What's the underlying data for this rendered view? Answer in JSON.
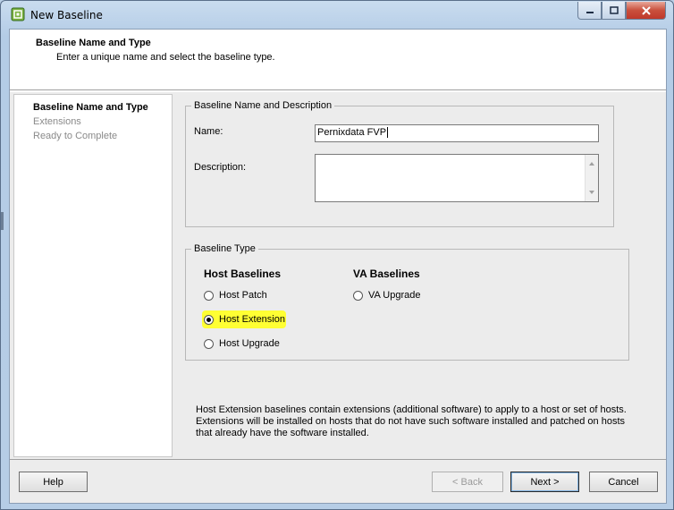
{
  "window": {
    "title": "New Baseline"
  },
  "header": {
    "title": "Baseline Name and Type",
    "subtitle": "Enter a unique name and select the baseline type."
  },
  "nav": {
    "items": [
      {
        "label": "Baseline Name and Type",
        "state": "active"
      },
      {
        "label": "Extensions",
        "state": "inactive"
      },
      {
        "label": "Ready to Complete",
        "state": "inactive"
      }
    ]
  },
  "name_group": {
    "legend": "Baseline Name and Description",
    "name_label": "Name:",
    "name_value": "Pernixdata FVP",
    "description_label": "Description:",
    "description_value": ""
  },
  "type_group": {
    "legend": "Baseline Type",
    "host_heading": "Host Baselines",
    "va_heading": "VA Baselines",
    "options": [
      {
        "label": "Host Patch",
        "checked": false
      },
      {
        "label": "Host Extension",
        "checked": true
      },
      {
        "label": "Host Upgrade",
        "checked": false
      },
      {
        "label": "VA Upgrade",
        "checked": false
      }
    ],
    "highlight_color": "#ffff33"
  },
  "description_text": "Host Extension baselines contain extensions (additional software) to apply to a host or set of hosts. Extensions will be installed on hosts that do not have such software installed and patched on hosts that already have the software installed.",
  "footer": {
    "help": "Help",
    "back": "< Back",
    "next": "Next >",
    "cancel": "Cancel"
  }
}
